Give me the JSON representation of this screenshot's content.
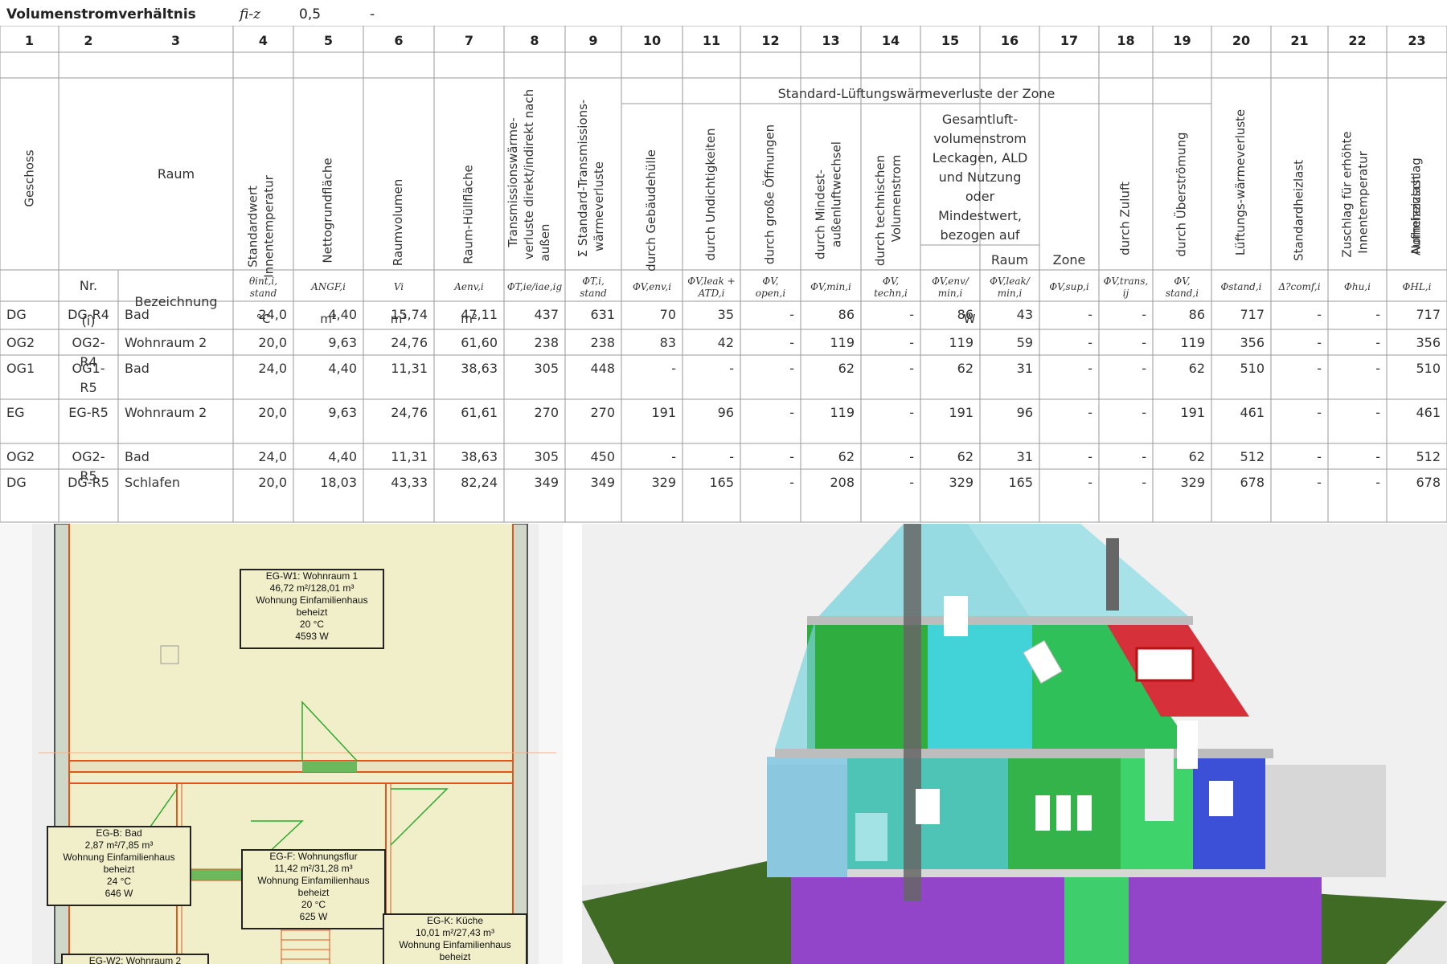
{
  "header": {
    "label": "Volumenstromverhältnis",
    "symbol": "fi-z",
    "value": "0,5",
    "unit": "-"
  },
  "column_numbers": [
    "1",
    "2",
    "3",
    "4",
    "5",
    "6",
    "7",
    "8",
    "9",
    "10",
    "11",
    "12",
    "13",
    "14",
    "15",
    "16",
    "17",
    "18",
    "19",
    "20",
    "21",
    "22",
    "23"
  ],
  "headers": {
    "geschoss": "Geschoss",
    "raum": "Raum",
    "std_innentemp_l1": "Standardwert",
    "std_innentemp_l2": "Innentemperatur",
    "nettogrund": "Nettogrundfläche",
    "raumvolumen": "Raumvolumen",
    "huellflaeche": "Raum-Hüllfläche",
    "trans_l1": "Transmissionswärme-",
    "trans_l2": "verluste direkt/indirekt nach",
    "trans_l3": "außen",
    "sum_trans_l1": "Σ Standard-Transmissions-",
    "sum_trans_l2": "wärmeverluste",
    "lueftung_group": "Standard-Lüftungswärmeverluste der Zone",
    "gebaeude": "durch Gebäudehülle",
    "undicht": "durch Undichtigkeiten",
    "offnungen": "durch große Öffnungen",
    "mindest_l1": "durch Mindest-",
    "mindest_l2": "außenluftwechsel",
    "technisch_l1": "durch technischen",
    "technisch_l2": "Volumenstrom",
    "gesamt": [
      "Gesamtluft-",
      "volumenstrom",
      "Leckagen, ALD",
      "und Nutzung",
      "oder",
      "Mindestwert,",
      "bezogen auf"
    ],
    "raum_sub": "Raum",
    "zone_sub": "Zone",
    "zuluft": "durch Zuluft",
    "ueberstroemung": "durch Überströmung",
    "lueftungsverluste": "Lüftungs-wärmeverluste",
    "standardheizlast": "Standardheizlast",
    "zuschlag_l1": "Zuschlag für erhöhte",
    "zuschlag_l2": "Innentemperatur",
    "aufheiz": "Aufheizzuschlag",
    "normheizlast": "Normheizlast",
    "nr": "Nr.",
    "bezeichnung": "Bezeichnung",
    "i_label": "(i)"
  },
  "symbols": [
    "θint,i, stand",
    "ANGF,i",
    "Vi",
    "Aenv,i",
    "ΦT,ie/iae,ig",
    "ΦT,i, stand",
    "ΦV,env,i",
    "ΦV,leak + ATD,i",
    "ΦV, open,i",
    "ΦV,min,i",
    "ΦV, techn,i",
    "ΦV,env/ min,i",
    "ΦV,leak/ min,i",
    "ΦV,sup,i",
    "ΦV,trans, ij",
    "ΦV, stand,i",
    "Φstand,i",
    "Δ?comf,i",
    "Φhu,i",
    "ΦHL,i"
  ],
  "units": {
    "temp": "°C",
    "area": "m²",
    "volume": "m³",
    "area2": "m²",
    "watt": "W"
  },
  "rows": [
    {
      "g": "DG",
      "nr": "DG-R4",
      "nr2": "",
      "bez": "Bad",
      "v": [
        "24,0",
        "4,40",
        "15,74",
        "47,11",
        "437",
        "631",
        "70",
        "35",
        "-",
        "86",
        "-",
        "86",
        "43",
        "-",
        "-",
        "86",
        "717",
        "-",
        "-",
        "717"
      ]
    },
    {
      "g": "OG2",
      "nr": "OG2-",
      "nr2": "R4",
      "bez": "Wohnraum 2",
      "v": [
        "20,0",
        "9,63",
        "24,76",
        "61,60",
        "238",
        "238",
        "83",
        "42",
        "-",
        "119",
        "-",
        "119",
        "59",
        "-",
        "-",
        "119",
        "356",
        "-",
        "-",
        "356"
      ]
    },
    {
      "g": "OG1",
      "nr": "OG1-",
      "nr2": "R5",
      "bez": "Bad",
      "v": [
        "24,0",
        "4,40",
        "11,31",
        "38,63",
        "305",
        "448",
        "-",
        "-",
        "-",
        "62",
        "-",
        "62",
        "31",
        "-",
        "-",
        "62",
        "510",
        "-",
        "-",
        "510"
      ]
    },
    {
      "g": "EG",
      "nr": "EG-R5",
      "nr2": "",
      "bez": "Wohnraum 2",
      "v": [
        "20,0",
        "9,63",
        "24,76",
        "61,61",
        "270",
        "270",
        "191",
        "96",
        "-",
        "119",
        "-",
        "191",
        "96",
        "-",
        "-",
        "191",
        "461",
        "-",
        "-",
        "461"
      ]
    },
    {
      "g": "OG2",
      "nr": "OG2-",
      "nr2": "R5",
      "bez": "Bad",
      "v": [
        "24,0",
        "4,40",
        "11,31",
        "38,63",
        "305",
        "450",
        "-",
        "-",
        "-",
        "62",
        "-",
        "62",
        "31",
        "-",
        "-",
        "62",
        "512",
        "-",
        "-",
        "512"
      ]
    },
    {
      "g": "DG",
      "nr": "DG-R5",
      "nr2": "",
      "bez": "Schlafen",
      "v": [
        "20,0",
        "18,03",
        "43,33",
        "82,24",
        "349",
        "349",
        "329",
        "165",
        "-",
        "208",
        "-",
        "329",
        "165",
        "-",
        "-",
        "329",
        "678",
        "-",
        "-",
        "678"
      ]
    }
  ],
  "plan": {
    "w1": [
      "EG-W1: Wohnraum 1",
      "46,72 m²/128,01 m³",
      "Wohnung Einfamilienhaus",
      "beheizt",
      "20 °C",
      "4593 W"
    ],
    "b": [
      "EG-B: Bad",
      "2,87 m²/7,85 m³",
      "Wohnung Einfamilienhaus",
      "beheizt",
      "24 °C",
      "646 W"
    ],
    "f": [
      "EG-F: Wohnungsflur",
      "11,42 m²/31,28 m³",
      "Wohnung Einfamilienhaus",
      "beheizt",
      "20 °C",
      "625 W"
    ],
    "k": [
      "EG-K: Küche",
      "10,01 m²/27,43 m³",
      "Wohnung Einfamilienhaus",
      "beheizt"
    ],
    "w2": [
      "EG-W2: Wohnraum 2"
    ]
  },
  "colors": {
    "grid": "#9a9a9a",
    "plan_fill": "#f1efc9",
    "plan_wall": "#e0561b",
    "zone_green": "#4cbb4c",
    "zone_cyan": "#3fd0d8",
    "zone_red": "#d9303a",
    "zone_blue": "#3a4fd8",
    "zone_purple": "#8a3fd0"
  }
}
